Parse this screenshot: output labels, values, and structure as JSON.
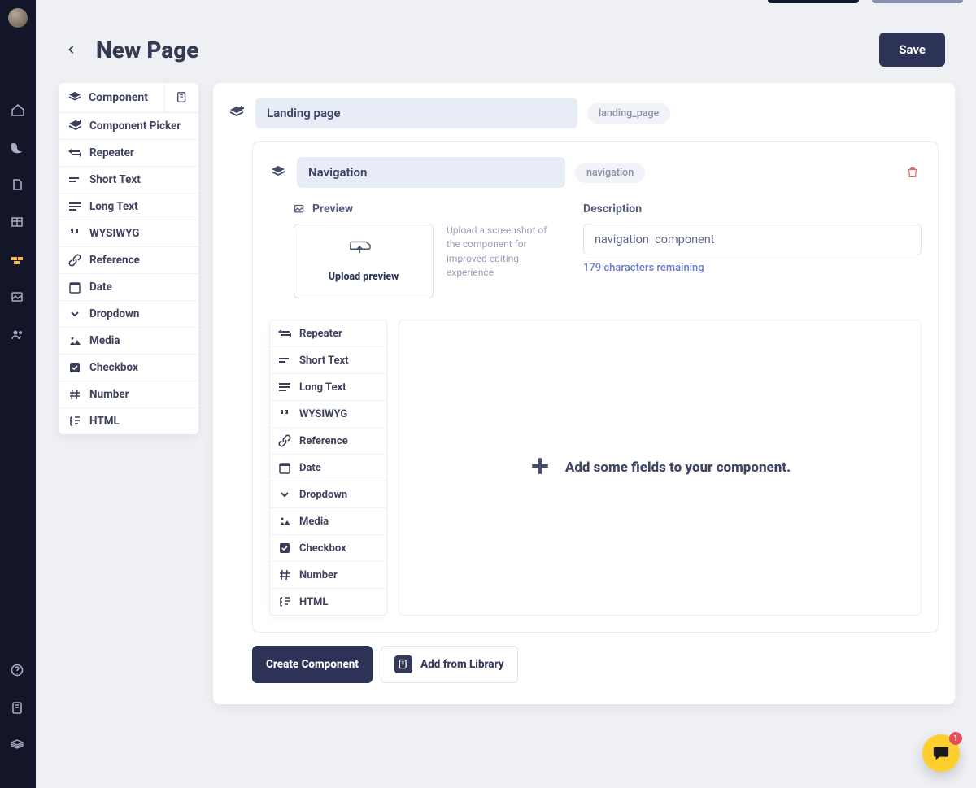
{
  "header": {
    "title": "New Page",
    "save_label": "Save"
  },
  "palette": {
    "tab_label": "Component",
    "items": [
      {
        "icon": "layers-plus",
        "label": "Component Picker"
      },
      {
        "icon": "repeat",
        "label": "Repeater"
      },
      {
        "icon": "short",
        "label": "Short Text"
      },
      {
        "icon": "long",
        "label": "Long Text"
      },
      {
        "icon": "quote",
        "label": "WYSIWYG"
      },
      {
        "icon": "link",
        "label": "Reference"
      },
      {
        "icon": "calendar",
        "label": "Date"
      },
      {
        "icon": "chevron",
        "label": "Dropdown"
      },
      {
        "icon": "media",
        "label": "Media"
      },
      {
        "icon": "check",
        "label": "Checkbox"
      },
      {
        "icon": "hash",
        "label": "Number"
      },
      {
        "icon": "html",
        "label": "HTML"
      }
    ]
  },
  "canvas": {
    "page_name": "Landing page",
    "page_slug": "landing_page",
    "component": {
      "name": "Navigation",
      "slug": "navigation",
      "preview_label": "Preview",
      "upload_label": "Upload preview",
      "upload_hint": "Upload a screenshot of the component for improved editing experience",
      "description_label": "Description",
      "description_value": "navigation  component",
      "chars_remaining": "179 characters remaining",
      "mini_palette": [
        {
          "icon": "repeat",
          "label": "Repeater"
        },
        {
          "icon": "short",
          "label": "Short Text"
        },
        {
          "icon": "long",
          "label": "Long Text"
        },
        {
          "icon": "quote",
          "label": "WYSIWYG"
        },
        {
          "icon": "link",
          "label": "Reference"
        },
        {
          "icon": "calendar",
          "label": "Date"
        },
        {
          "icon": "chevron",
          "label": "Dropdown"
        },
        {
          "icon": "media",
          "label": "Media"
        },
        {
          "icon": "check",
          "label": "Checkbox"
        },
        {
          "icon": "hash",
          "label": "Number"
        },
        {
          "icon": "html",
          "label": "HTML"
        }
      ],
      "dropzone_text": "Add some fields to your component."
    },
    "buttons": {
      "create_component": "Create Component",
      "add_from_library": "Add from Library"
    }
  },
  "intercom": {
    "badge": "1"
  }
}
